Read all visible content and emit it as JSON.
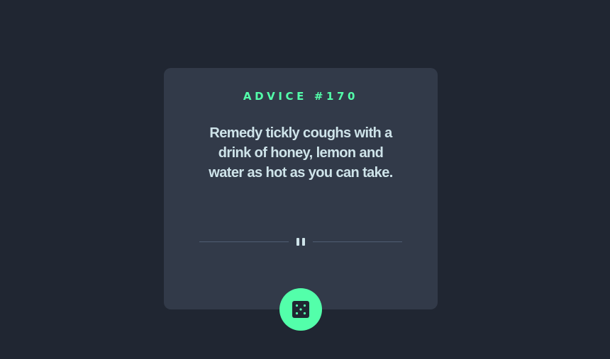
{
  "advice": {
    "title": "ADVICE #170",
    "text": "Remedy tickly coughs with a drink of honey, lemon and water as hot as you can take."
  },
  "divider": {
    "icon": "pause-icon"
  },
  "dice_button": {
    "icon": "dice-icon"
  },
  "colors": {
    "background": "#202632",
    "card": "#323a49",
    "accent": "#53ffaa",
    "text": "#cee3e9",
    "divider": "#4f5d74"
  }
}
